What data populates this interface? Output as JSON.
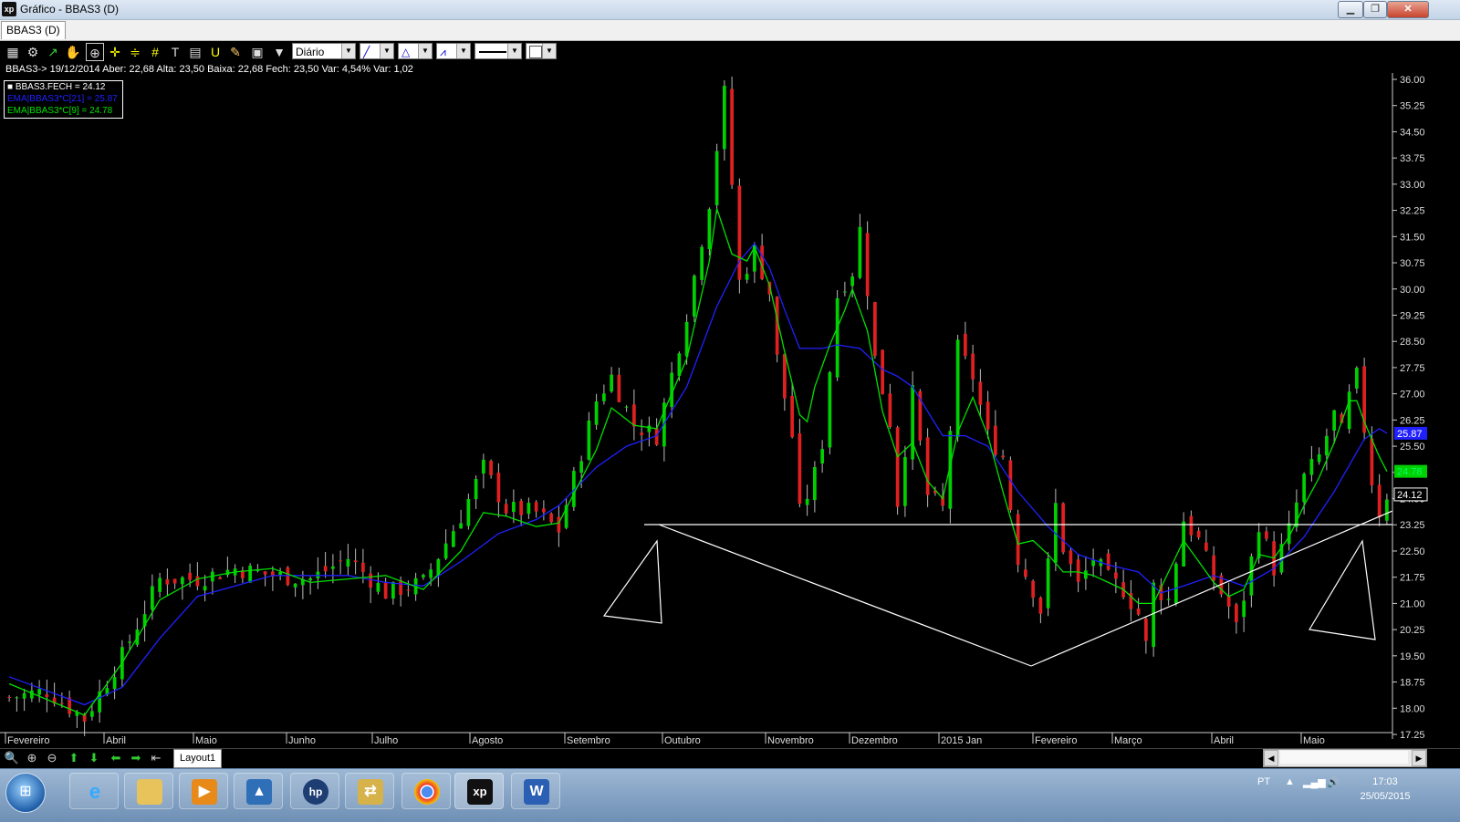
{
  "window": {
    "title": "Gráfico - BBAS3 (D)"
  },
  "tab": {
    "label": "BBAS3 (D)"
  },
  "toolbar": {
    "period": "Diário"
  },
  "info_line": "BBAS3-> 19/12/2014 Aber: 22,68 Alta: 23,50 Baixa: 22,68 Fech: 23,50 Var: 4,54% Var: 1,02",
  "legend": {
    "close": "BBAS3.FECH = 24.12",
    "ema21": "EMA|BBAS3*C[21] = 25.87",
    "ema9": "EMA|BBAS3*C[9] = 24.78"
  },
  "colors": {
    "up": "#00d000",
    "down": "#e02020",
    "ema9": "#00e000",
    "ema21": "#2020ff",
    "lines": "#ffffff"
  },
  "chart_data": {
    "type": "candlestick",
    "symbol": "BBAS3",
    "ylim": [
      17.25,
      36.0
    ],
    "y_ticks": [
      "36.00",
      "35.25",
      "34.50",
      "33.75",
      "33.00",
      "32.25",
      "31.50",
      "30.75",
      "30.00",
      "29.25",
      "28.50",
      "27.75",
      "27.00",
      "26.25",
      "25.50",
      "24.75",
      "24.00",
      "23.25",
      "22.50",
      "21.75",
      "21.00",
      "20.25",
      "19.50",
      "18.75",
      "18.00",
      "17.25"
    ],
    "x_labels": [
      "Fevereiro",
      "Abril",
      "Maio",
      "Junho",
      "Julho",
      "Agosto",
      "Setembro",
      "Outubro",
      "Novembro",
      "Dezembro",
      "2015 Jan",
      "Fevereiro",
      "Março",
      "Abril",
      "Maio"
    ],
    "price_tags": [
      "25.87",
      "24.78",
      "24.12"
    ],
    "close_path": [
      [
        0,
        18.3
      ],
      [
        5,
        18.5
      ],
      [
        10,
        17.7
      ],
      [
        15,
        19.5
      ],
      [
        20,
        21.7
      ],
      [
        25,
        21.7
      ],
      [
        30,
        22.0
      ],
      [
        35,
        21.8
      ],
      [
        40,
        21.7
      ],
      [
        45,
        22.3
      ],
      [
        50,
        21.3
      ],
      [
        55,
        21.6
      ],
      [
        60,
        23.5
      ],
      [
        63,
        24.9
      ],
      [
        66,
        23.7
      ],
      [
        70,
        23.6
      ],
      [
        73,
        23.1
      ],
      [
        78,
        26.8
      ],
      [
        80,
        27.5
      ],
      [
        83,
        26.1
      ],
      [
        86,
        25.8
      ],
      [
        90,
        29.3
      ],
      [
        93,
        32.5
      ],
      [
        95,
        35.6
      ],
      [
        96,
        33.0
      ],
      [
        97,
        30.2
      ],
      [
        99,
        31.1
      ],
      [
        101,
        29.9
      ],
      [
        102,
        28.0
      ],
      [
        104,
        25.8
      ],
      [
        105,
        23.6
      ],
      [
        106,
        24.1
      ],
      [
        107,
        24.7
      ],
      [
        108,
        25.6
      ],
      [
        110,
        29.8
      ],
      [
        111,
        30.2
      ],
      [
        112,
        30.5
      ],
      [
        113,
        31.7
      ],
      [
        114,
        30.0
      ],
      [
        115,
        28.0
      ],
      [
        117,
        26.2
      ],
      [
        118,
        23.9
      ],
      [
        120,
        27.0
      ],
      [
        122,
        24.1
      ],
      [
        124,
        23.7
      ],
      [
        126,
        28.3
      ],
      [
        128,
        27.5
      ],
      [
        130,
        25.8
      ],
      [
        132,
        25.2
      ],
      [
        134,
        22.3
      ],
      [
        136,
        21.4
      ],
      [
        137,
        20.8
      ],
      [
        138,
        22.1
      ],
      [
        139,
        23.8
      ],
      [
        140,
        22.6
      ],
      [
        142,
        21.5
      ],
      [
        144,
        22.3
      ],
      [
        146,
        21.7
      ],
      [
        148,
        21.4
      ],
      [
        150,
        20.7
      ],
      [
        151,
        19.8
      ],
      [
        152,
        21.5
      ],
      [
        154,
        21.1
      ],
      [
        156,
        23.4
      ],
      [
        158,
        22.8
      ],
      [
        160,
        21.7
      ],
      [
        162,
        20.9
      ],
      [
        163,
        20.3
      ],
      [
        164,
        21.2
      ],
      [
        166,
        23.3
      ],
      [
        168,
        22.0
      ],
      [
        170,
        23.1
      ],
      [
        172,
        24.6
      ],
      [
        174,
        25.2
      ],
      [
        176,
        26.4
      ],
      [
        177,
        25.9
      ],
      [
        178,
        26.9
      ],
      [
        179,
        27.5
      ],
      [
        180,
        26.0
      ],
      [
        181,
        24.5
      ],
      [
        182,
        23.6
      ],
      [
        183,
        24.12
      ]
    ],
    "ema9_path": [
      [
        0,
        18.7
      ],
      [
        10,
        17.8
      ],
      [
        15,
        19.3
      ],
      [
        20,
        21.1
      ],
      [
        25,
        21.7
      ],
      [
        30,
        21.9
      ],
      [
        35,
        22.0
      ],
      [
        40,
        21.6
      ],
      [
        45,
        21.7
      ],
      [
        50,
        21.8
      ],
      [
        55,
        21.4
      ],
      [
        60,
        22.5
      ],
      [
        63,
        23.6
      ],
      [
        66,
        23.5
      ],
      [
        70,
        23.2
      ],
      [
        73,
        23.3
      ],
      [
        78,
        25.4
      ],
      [
        80,
        26.6
      ],
      [
        83,
        26.1
      ],
      [
        86,
        26.0
      ],
      [
        90,
        28.0
      ],
      [
        93,
        30.8
      ],
      [
        94,
        32.3
      ],
      [
        96,
        31.0
      ],
      [
        98,
        30.8
      ],
      [
        99,
        31.2
      ],
      [
        101,
        30.1
      ],
      [
        103,
        28.2
      ],
      [
        105,
        26.4
      ],
      [
        106,
        26.2
      ],
      [
        107,
        27.2
      ],
      [
        109,
        28.4
      ],
      [
        111,
        29.4
      ],
      [
        112,
        30.0
      ],
      [
        114,
        28.8
      ],
      [
        116,
        26.5
      ],
      [
        118,
        25.2
      ],
      [
        120,
        25.6
      ],
      [
        122,
        24.5
      ],
      [
        124,
        24.0
      ],
      [
        126,
        25.9
      ],
      [
        128,
        26.9
      ],
      [
        130,
        25.8
      ],
      [
        132,
        24.2
      ],
      [
        134,
        22.7
      ],
      [
        136,
        22.8
      ],
      [
        138,
        22.4
      ],
      [
        140,
        21.9
      ],
      [
        142,
        21.9
      ],
      [
        144,
        21.8
      ],
      [
        146,
        21.6
      ],
      [
        148,
        21.4
      ],
      [
        150,
        21.0
      ],
      [
        152,
        21.0
      ],
      [
        154,
        21.9
      ],
      [
        156,
        22.8
      ],
      [
        158,
        22.2
      ],
      [
        160,
        21.6
      ],
      [
        162,
        21.2
      ],
      [
        164,
        21.4
      ],
      [
        166,
        22.4
      ],
      [
        168,
        22.3
      ],
      [
        170,
        22.9
      ],
      [
        172,
        23.8
      ],
      [
        174,
        24.6
      ],
      [
        176,
        25.6
      ],
      [
        178,
        26.8
      ],
      [
        179,
        26.8
      ],
      [
        180,
        26.2
      ],
      [
        182,
        25.2
      ],
      [
        183,
        24.78
      ]
    ],
    "ema21_path": [
      [
        0,
        18.9
      ],
      [
        10,
        18.1
      ],
      [
        15,
        18.6
      ],
      [
        20,
        20.0
      ],
      [
        25,
        21.2
      ],
      [
        30,
        21.5
      ],
      [
        35,
        21.8
      ],
      [
        40,
        21.8
      ],
      [
        45,
        21.8
      ],
      [
        50,
        21.6
      ],
      [
        55,
        21.5
      ],
      [
        60,
        22.2
      ],
      [
        65,
        23.0
      ],
      [
        70,
        23.4
      ],
      [
        73,
        23.8
      ],
      [
        78,
        24.9
      ],
      [
        82,
        25.5
      ],
      [
        86,
        25.8
      ],
      [
        90,
        27.2
      ],
      [
        94,
        29.5
      ],
      [
        97,
        30.8
      ],
      [
        99,
        31.3
      ],
      [
        101,
        30.6
      ],
      [
        103,
        29.4
      ],
      [
        105,
        28.3
      ],
      [
        108,
        28.3
      ],
      [
        110,
        28.4
      ],
      [
        113,
        28.3
      ],
      [
        116,
        27.7
      ],
      [
        118,
        27.5
      ],
      [
        120,
        27.2
      ],
      [
        124,
        25.8
      ],
      [
        127,
        25.8
      ],
      [
        130,
        25.5
      ],
      [
        134,
        24.2
      ],
      [
        138,
        23.2
      ],
      [
        142,
        22.4
      ],
      [
        146,
        22.1
      ],
      [
        150,
        21.9
      ],
      [
        153,
        21.3
      ],
      [
        156,
        21.5
      ],
      [
        160,
        21.8
      ],
      [
        164,
        21.5
      ],
      [
        168,
        22.0
      ],
      [
        172,
        22.9
      ],
      [
        176,
        24.2
      ],
      [
        180,
        25.7
      ],
      [
        182,
        26.0
      ],
      [
        183,
        25.87
      ]
    ]
  }
}
